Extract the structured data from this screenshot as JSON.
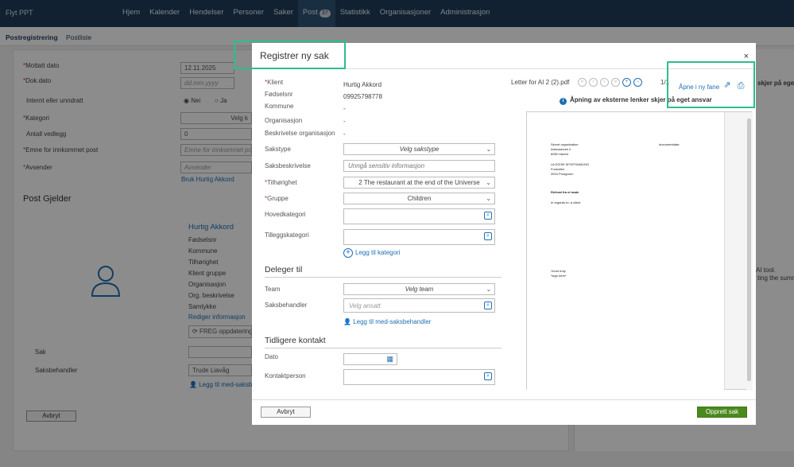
{
  "app": {
    "title": "Flyt PPT"
  },
  "nav": {
    "items": [
      "Hjem",
      "Kalender",
      "Hendelser",
      "Personer",
      "Saker",
      "Post",
      "Statistikk",
      "Organisasjoner",
      "Administrasjon"
    ],
    "post_badge": "37"
  },
  "subnav": {
    "tabs": [
      "Postregistrering",
      "Postliste"
    ]
  },
  "background_form": {
    "mottatt_dato_label": "Mottatt dato",
    "mottatt_dato_value": "12.11.2025",
    "dok_dato_label": "Dok.dato",
    "dok_dato_placeholder": "dd.mm.yyyy",
    "internt_label": "Internt eller unndratt",
    "nei": "Nei",
    "ja": "Ja",
    "kategori_label": "Kategori",
    "kategori_value": "Velg k",
    "antall_label": "Antall vedlegg",
    "antall_value": "0",
    "emne_label": "Emne for innkommet post",
    "emne_placeholder": "Emne for innkommet po",
    "avsender_label": "Avsender",
    "avsender_placeholder": "Avsender",
    "bruk_link": "Bruk Hurtig Akkord",
    "post_gjelder": "Post Gjelder",
    "client_name": "Hurtig Akkord",
    "client_fields": [
      "Fødselsnr",
      "Kommune",
      "Tilhørighet",
      "Klient gruppe",
      "Organisasjon",
      "Org. beskrivelse",
      "Samtykke"
    ],
    "rediger_link": "Rediger informasjon",
    "freg_button": "FREG oppdatering",
    "sak_label": "Sak",
    "saksbehandler_label": "Saksbehandler",
    "saksbehandler_value": "Trude Liavåg",
    "legg_til_link": "Legg til med-saksb",
    "avbryt": "Avbryt",
    "right_snip1": "skjer på eget",
    "right_snip2": "AI tool.",
    "right_snip3": "ting the summ"
  },
  "modal": {
    "title": "Registrer ny sak",
    "close": "×",
    "fields": {
      "klient_label": "Klient",
      "klient_value": "Hurtig Akkord",
      "fodselsnr_label": "Fødselsnr",
      "fodselsnr_value": "09925798778",
      "kommune_label": "Kommune",
      "kommune_value": "-",
      "organisasjon_label": "Organisasjon",
      "organisasjon_value": "-",
      "besk_org_label": "Beskrivelse organisasjon",
      "besk_org_value": "-",
      "sakstype_label": "Sakstype",
      "sakstype_value": "Velg sakstype",
      "saksbeskrivelse_label": "Saksbeskrivelse",
      "saksbeskrivelse_placeholder": "Unngå sensitiv informasjon",
      "tilhorighet_label": "Tilhørighet",
      "tilhorighet_value": "2 The restaurant at the end of the Universe",
      "gruppe_label": "Gruppe",
      "gruppe_value": "Children",
      "hovedkategori_label": "Hovedkategori",
      "tilleggskategori_label": "Tilleggskategori",
      "legg_til_kategori": "Legg til kategori"
    },
    "deleger": {
      "heading": "Deleger til",
      "team_label": "Team",
      "team_value": "Velg team",
      "saksbehandler_label": "Saksbehandler",
      "saksbehandler_placeholder": "Velg ansatt",
      "legg_til": "Legg til med-saksbehandler"
    },
    "tidligere": {
      "heading": "Tidligere kontakt",
      "dato_label": "Dato",
      "kontaktperson_label": "Kontaktperson"
    },
    "preview": {
      "filename": "Letter for AI 2 (2).pdf",
      "page": "1/1",
      "open_new_tab": "Åpne i ny fane",
      "info": "Åpning av eksterne lenker skjer på eget ansvar",
      "doc_lines": [
        "Secret organization",
        "Adresseiveii 4",
        "6060 Hareid",
        "ULOGISK MYNTSAMLING",
        "Funkollen",
        "3924 Porsgrunn",
        "Referat fra et møte",
        "In regards to: a client",
        "Yours truly",
        "*sign here*"
      ],
      "doc_right": "documentdate:"
    },
    "footer": {
      "cancel": "Avbryt",
      "submit": "Opprett sak"
    }
  }
}
